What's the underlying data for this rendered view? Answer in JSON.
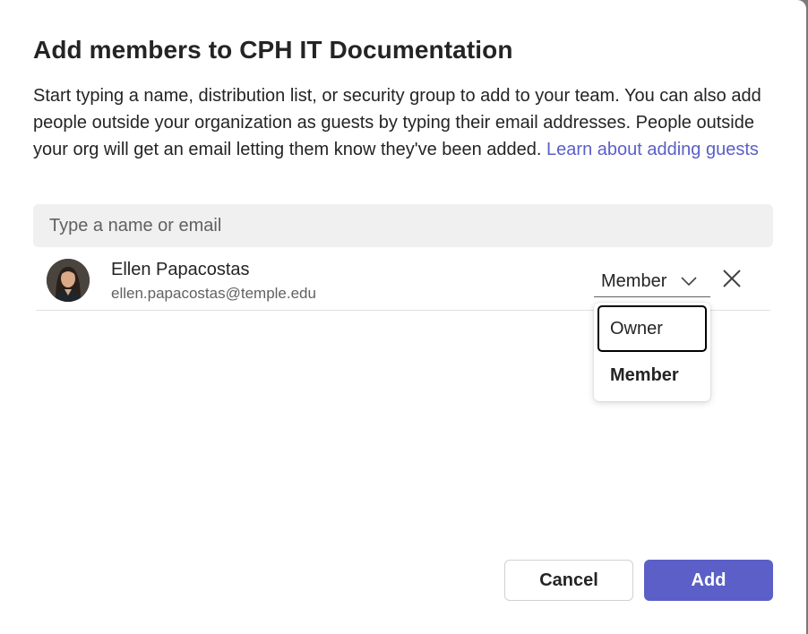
{
  "dialog": {
    "title": "Add members to CPH IT Documentation",
    "description": "Start typing a name, distribution list, or security group to add to your team. You can also add people outside your organization as guests by typing their email addresses. People outside your org will get an email letting them know they've been added. ",
    "learn_link": "Learn about adding guests"
  },
  "search": {
    "placeholder": "Type a name or email"
  },
  "member": {
    "name": "Ellen Papacostas",
    "email": "ellen.papacostas@temple.edu",
    "role": "Member",
    "avatar_icon": "user-avatar-photo",
    "remove_icon": "close-icon",
    "dropdown_icon": "chevron-down-icon"
  },
  "role_dropdown": {
    "options": [
      "Owner",
      "Member"
    ],
    "focused": "Owner",
    "selected": "Member"
  },
  "buttons": {
    "cancel": "Cancel",
    "add": "Add"
  },
  "colors": {
    "accent": "#5b5fc7",
    "link": "#5b5fc7"
  }
}
